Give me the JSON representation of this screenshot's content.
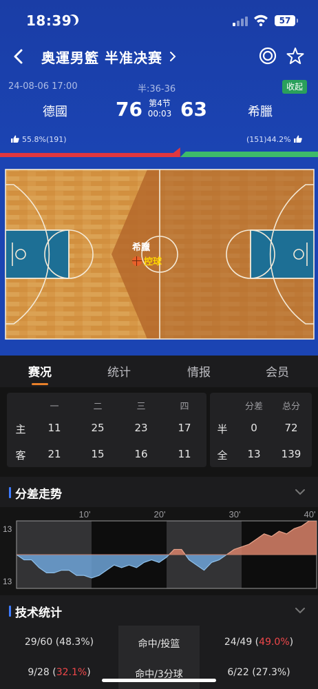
{
  "status_bar": {
    "time": "18:39",
    "battery": "57"
  },
  "nav": {
    "title": "奥運男籃 半准决赛"
  },
  "match": {
    "datetime": "24-08-06 17:00",
    "half_score": "半:36-36",
    "collapse_label": "收起",
    "home_team": "德國",
    "away_team": "希臘",
    "home_score": "76",
    "away_score": "63",
    "period": "第4节",
    "clock": "00:03",
    "home_support": "55.8%(191)",
    "away_support": "(151)44.2%",
    "home_support_pct": 55.8
  },
  "court": {
    "possession_team": "希臘",
    "possession_label": "控球"
  },
  "tabs": [
    {
      "label": "赛况",
      "active": true
    },
    {
      "label": "统计",
      "active": false
    },
    {
      "label": "情报",
      "active": false
    },
    {
      "label": "会员",
      "active": false
    }
  ],
  "quarters": {
    "headers": [
      "一",
      "二",
      "三",
      "四"
    ],
    "rows": [
      {
        "label": "主",
        "values": [
          "11",
          "25",
          "23",
          "17"
        ]
      },
      {
        "label": "客",
        "values": [
          "21",
          "15",
          "16",
          "11"
        ]
      }
    ]
  },
  "totals": {
    "headers": [
      "分差",
      "总分"
    ],
    "rows": [
      {
        "label": "半",
        "values": [
          "0",
          "72"
        ]
      },
      {
        "label": "全",
        "values": [
          "13",
          "139"
        ]
      }
    ]
  },
  "diff_section": {
    "title": "分差走势"
  },
  "chart_data": {
    "type": "area",
    "x_ticks": [
      "10'",
      "20'",
      "30'",
      "40'"
    ],
    "y_labels": [
      "13",
      "13"
    ],
    "ylim": [
      -13,
      13
    ],
    "xlim": [
      0,
      40
    ],
    "x": [
      0,
      1,
      2,
      3,
      4,
      5,
      6,
      7,
      8,
      9,
      10,
      11,
      12,
      13,
      14,
      15,
      16,
      17,
      18,
      19,
      20,
      21,
      22,
      23,
      24,
      25,
      26,
      27,
      28,
      29,
      30,
      31,
      32,
      33,
      34,
      35,
      36,
      37,
      38,
      39,
      40
    ],
    "values": [
      0,
      -2,
      -2,
      -5,
      -7,
      -7,
      -6,
      -6,
      -8,
      -8,
      -9,
      -8,
      -6,
      -4,
      -5,
      -4,
      -5,
      -3,
      -2,
      -3,
      -1,
      2,
      2,
      -2,
      -4,
      -6,
      -3,
      -2,
      0,
      2,
      3,
      4,
      6,
      8,
      7,
      9,
      8,
      10,
      11,
      13,
      13
    ],
    "colors": {
      "positive": "#d9826a",
      "negative": "#6fa5d8"
    }
  },
  "stats_section": {
    "title": "技术统计",
    "rows": [
      {
        "label": "命中/投篮",
        "home": "29/60",
        "home_pct": "(48.3%)",
        "home_red": false,
        "away": "24/49",
        "away_pct": "49.0%",
        "away_red": true
      },
      {
        "label": "命中/3分球",
        "home": "9/28",
        "home_pct": "32.1%",
        "home_red": true,
        "away": "6/22",
        "away_pct": "(27.3%)",
        "away_red": false
      }
    ]
  }
}
